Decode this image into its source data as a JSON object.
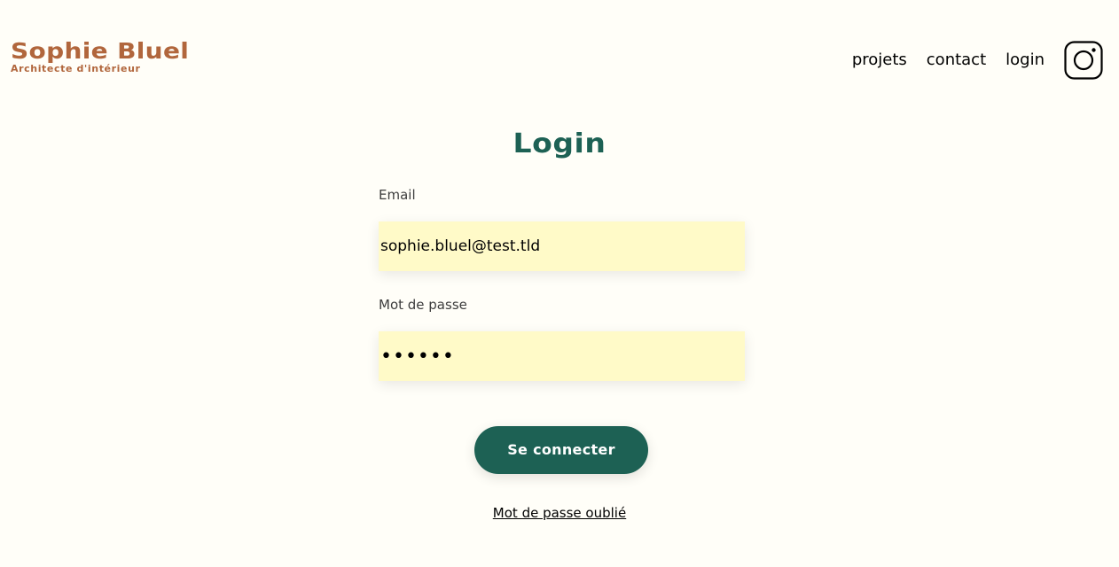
{
  "brand": {
    "title": "Sophie Bluel",
    "subtitle": "Architecte d'intérieur",
    "color": "#B1663C"
  },
  "nav": {
    "items": [
      {
        "label": "projets"
      },
      {
        "label": "contact"
      },
      {
        "label": "login"
      }
    ],
    "social_icon": "instagram-icon"
  },
  "login": {
    "title": "Login",
    "email_label": "Email",
    "email_value": "sophie.bluel@test.tld",
    "password_label": "Mot de passe",
    "password_value": "••••••",
    "submit_label": "Se connecter",
    "forgot_label": "Mot de passe oublié"
  },
  "colors": {
    "accent": "#1D6154",
    "background": "#FFFEF8",
    "input_bg": "#FFFAC8"
  }
}
